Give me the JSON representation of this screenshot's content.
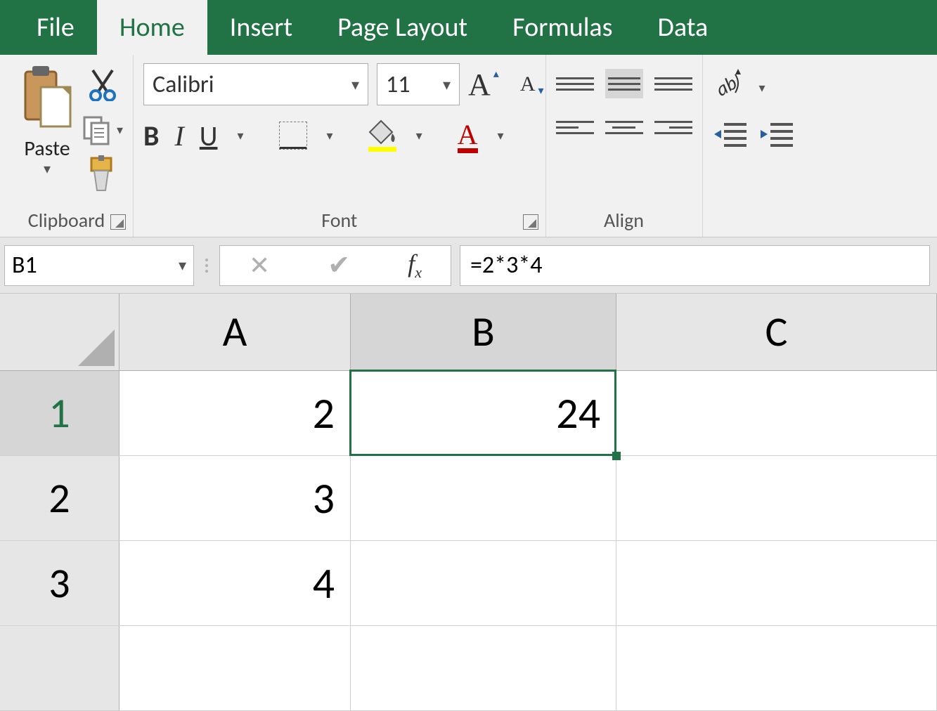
{
  "tabs": {
    "file": "File",
    "home": "Home",
    "insert": "Insert",
    "page_layout": "Page Layout",
    "formulas": "Formulas",
    "data": "Data"
  },
  "ribbon": {
    "clipboard": {
      "label": "Clipboard",
      "paste": "Paste"
    },
    "font": {
      "label": "Font",
      "name": "Calibri",
      "size": "11",
      "bold": "B",
      "italic": "I",
      "underline": "U"
    },
    "alignment": {
      "label": "Align"
    }
  },
  "namebox": "B1",
  "formula": "=2*3*4",
  "columns": [
    "A",
    "B",
    "C"
  ],
  "rows": [
    "1",
    "2",
    "3"
  ],
  "cells": {
    "A1": "2",
    "A2": "3",
    "A3": "4",
    "B1": "24"
  },
  "selected_cell": "B1"
}
